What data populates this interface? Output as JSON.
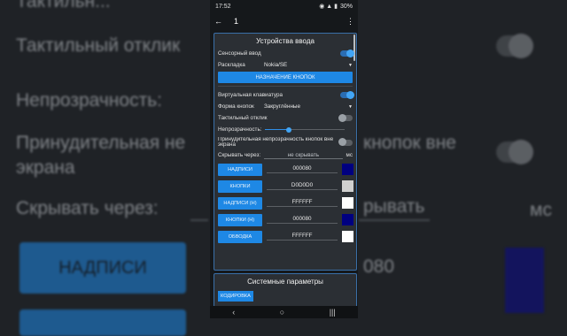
{
  "background": {
    "top_partial": "Тактильн...",
    "tactile": "Тактильный отклик",
    "opacity": "Непрозрачность:",
    "forced": "Принудительная не",
    "forced_rest": "кнопок вне",
    "screen": "экрана",
    "hide": "Скрывать через:",
    "hide_rest": "рывать",
    "ms": "мс",
    "btn_captions": "НАДПИСИ",
    "value_partial": "080"
  },
  "status": {
    "time": "17:52",
    "icons": "◉ ▲ ▮",
    "battery": "30%"
  },
  "topbar": {
    "back_icon": "←",
    "title": "1",
    "menu_icon": "⋮"
  },
  "input_panel": {
    "title": "Устройства ввода",
    "touch_input": "Сенсорный ввод",
    "layout_label": "Раскладка",
    "layout_value": "Nokia/SE",
    "assign_button": "НАЗНАЧЕНИЕ КНОПОК",
    "virtual_keyboard": "Виртуальная клавиатура",
    "button_shape_label": "Форма кнопок",
    "button_shape_value": "Закруглённые",
    "tactile": "Тактильный отклик",
    "opacity_label": "Непрозрачность:",
    "opacity_value": 0.3,
    "forced_opacity": "Принудительная непрозрачность кнопок вне экрана",
    "hide_label": "Скрывать через:",
    "hide_value": "не скрывать",
    "hide_unit": "мс",
    "colors": [
      {
        "label": "НАДПИСИ",
        "value": "000080",
        "swatch": "#000080"
      },
      {
        "label": "КНОПКИ",
        "value": "D0D0D0",
        "swatch": "#D0D0D0"
      },
      {
        "label": "НАДПИСИ (H)",
        "value": "FFFFFF",
        "swatch": "#FFFFFF"
      },
      {
        "label": "КНОПКИ (H)",
        "value": "000080",
        "swatch": "#000080"
      },
      {
        "label": "ОБВОДКА",
        "value": "FFFFFF",
        "swatch": "#FFFFFF"
      }
    ]
  },
  "system_panel": {
    "title": "Системные параметры",
    "encoding_button": "КОДИРОВКА"
  },
  "navbar": {
    "back": "‹",
    "home": "○",
    "recents": "|||"
  }
}
